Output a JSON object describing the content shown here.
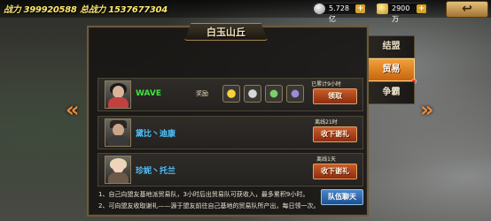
{
  "top_bar": {
    "power_label": "战力",
    "power_value": "399920588",
    "total_power_label": "总战力",
    "total_power_value": "1537677304",
    "silver": "5.728亿",
    "gold": "2900万",
    "plus": "+",
    "back": "↩"
  },
  "panel": {
    "title": "白玉山丘",
    "reward_label": "奖励"
  },
  "members": [
    {
      "name": "WAVE",
      "name_color": "#3ce63c",
      "status": "已累计9小时",
      "action": "领取"
    },
    {
      "name": "黛比丶迪康",
      "name_color": "#4fc3ff",
      "status": "离线21时",
      "action": "收下谢礼"
    },
    {
      "name": "珍妮丶托兰",
      "name_color": "#4fc3ff",
      "status": "离线1天",
      "action": "收下谢礼"
    }
  ],
  "reward_icons": [
    "fruit-icon",
    "silver-coin-icon",
    "mask-icon",
    "soldier-icon"
  ],
  "notes": [
    "1、自己向盟友基地派贸易队，3小时后出贸易队可获收入，最多累积9小时。",
    "2、可向盟友收取谢礼——源于盟友前往自己基地的贸易队所产出，每日领一次。"
  ],
  "chat_button": "队伍聊天",
  "tabs": [
    {
      "label": "结盟",
      "active": false
    },
    {
      "label": "贸易",
      "active": true
    },
    {
      "label": "争霸",
      "active": false
    }
  ],
  "arrows": {
    "left": "«",
    "right": "»"
  }
}
